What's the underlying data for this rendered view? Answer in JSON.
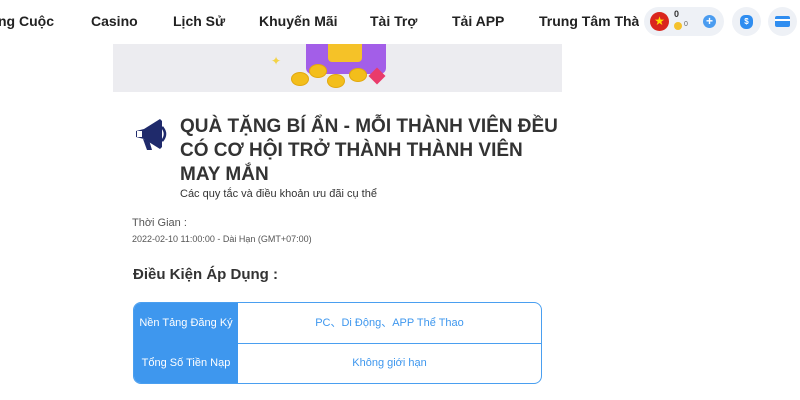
{
  "nav": {
    "items": [
      "ng Cuộc",
      "Casino",
      "Lịch Sử",
      "Khuyến Mãi",
      "Tài Trợ",
      "Tải APP"
    ],
    "partial_item": "Trung Tâm Thàn"
  },
  "wallet": {
    "balance": "0",
    "sub_balance": "0",
    "plus": "+"
  },
  "icons": {
    "flag": "vietnam-flag-icon",
    "plus": "plus-icon",
    "money_bag": "money-bag-icon",
    "card": "credit-card-icon",
    "megaphone": "megaphone-icon"
  },
  "money_bag_symbol": "$",
  "promo": {
    "title": "QUÀ TẶNG BÍ ẨN - MỖI THÀNH VIÊN ĐỀU CÓ CƠ HỘI TRỞ THÀNH THÀNH VIÊN MAY MẮN",
    "subtitle": "Các quy tắc và điều khoản ưu đãi cụ thể",
    "time_label": "Thời Gian :",
    "time_value": "2022-02-10 11:00:00 - Dài Hạn (GMT+07:00)",
    "conditions_title": "Điều Kiện Áp Dụng :",
    "conditions": [
      {
        "label": "Nền Tảng Đăng Ký",
        "value": "PC、Di Động、APP Thể Thao"
      },
      {
        "label": "Tổng Số Tiền Nạp",
        "value": "Không giới hạn"
      }
    ]
  },
  "colors": {
    "accent": "#3e97ee",
    "megaphone": "#1f2a6b",
    "flag_red": "#da251d",
    "text_dark": "#333333"
  }
}
